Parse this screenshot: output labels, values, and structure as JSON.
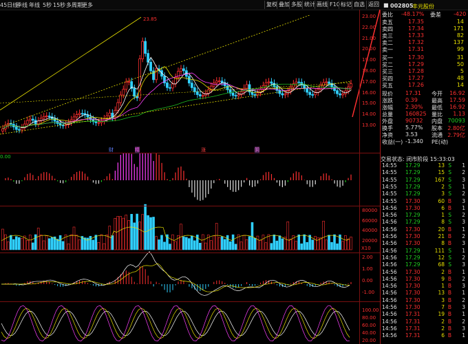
{
  "toolbar": {
    "tabs": [
      "45日线",
      "季线",
      "年线",
      "5秒",
      "15秒",
      "多周期",
      "更多"
    ],
    "buttons": [
      "复权",
      "叠加",
      "多股",
      "统计",
      "画线",
      "F10",
      "标记",
      "自选",
      "返回"
    ]
  },
  "stock": {
    "code": "002805",
    "name": "丰元股份"
  },
  "chart": {
    "high_label": "23.85",
    "price_ticks": [
      "23.00",
      "22.00",
      "21.00",
      "20.00",
      "19.00",
      "18.00",
      "17.00",
      "16.00",
      "15.00",
      "14.00",
      "13.00"
    ],
    "event_markers": [
      "财",
      "精",
      "涨",
      "阴"
    ],
    "macd_zero": "0.00",
    "vol_ticks": [
      "80000",
      "60000",
      "40000",
      "20000"
    ],
    "vol_unit": "X10",
    "osc_ticks": [
      "2.00",
      "1.00",
      "0.00",
      "-1.00"
    ],
    "kdj_ticks": [
      "100.00",
      "80.00",
      "60.00",
      "40.00",
      "20.00"
    ]
  },
  "quote": {
    "weibi_label": "委比",
    "weibi": "-48.17%",
    "weicha_label": "委差",
    "weicha": "-420",
    "asks": [
      {
        "label": "卖五",
        "price": "17.35",
        "vol": "14"
      },
      {
        "label": "卖四",
        "price": "17.34",
        "vol": "171"
      },
      {
        "label": "卖三",
        "price": "17.33",
        "vol": "82"
      },
      {
        "label": "卖二",
        "price": "17.32",
        "vol": "137"
      },
      {
        "label": "卖一",
        "price": "17.31",
        "vol": "99"
      }
    ],
    "bids": [
      {
        "label": "买一",
        "price": "17.30",
        "vol": "31"
      },
      {
        "label": "买二",
        "price": "17.29",
        "vol": "50"
      },
      {
        "label": "买三",
        "price": "17.28",
        "vol": "5"
      },
      {
        "label": "买四",
        "price": "17.27",
        "vol": "48"
      },
      {
        "label": "买五",
        "price": "17.26",
        "vol": "14"
      }
    ],
    "stats": [
      {
        "l1": "现价",
        "v1": "17.31",
        "l2": "今开",
        "v2": "16.92"
      },
      {
        "l1": "涨跌",
        "v1": "0.39",
        "l2": "最高",
        "v2": "17.59"
      },
      {
        "l1": "涨幅",
        "v1": "2.30%",
        "l2": "最低",
        "v2": "16.92"
      },
      {
        "l1": "总量",
        "v1": "160825",
        "l2": "量比",
        "v2": "1.13"
      },
      {
        "l1": "外盘",
        "v1": "90732",
        "l2": "内盘",
        "v2": "70093"
      },
      {
        "l1": "换手",
        "v1": "5.77%",
        "l2": "股本",
        "v2": "2.80亿"
      },
      {
        "l1": "净资",
        "v1": "3.53",
        "l2": "流通",
        "v2": "2.79亿"
      },
      {
        "l1": "收益(一)",
        "v1": "-1.340",
        "l2": "PE(动)",
        "v2": ""
      }
    ],
    "trade_status": "交易状态: 闭市阶段 15:33:03"
  },
  "ticks": [
    {
      "t": "14:55",
      "p": "17.29",
      "v": "13",
      "d": "S"
    },
    {
      "t": "14:55",
      "p": "17.29",
      "v": "15",
      "d": "S"
    },
    {
      "t": "14:55",
      "p": "17.29",
      "v": "167",
      "d": "S"
    },
    {
      "t": "14:55",
      "p": "17.29",
      "v": "2",
      "d": "S"
    },
    {
      "t": "14:55",
      "p": "17.29",
      "v": "3",
      "d": "S"
    },
    {
      "t": "14:55",
      "p": "17.30",
      "v": "60",
      "d": "B"
    },
    {
      "t": "14:56",
      "p": "17.30",
      "v": "6",
      "d": "B"
    },
    {
      "t": "14:56",
      "p": "17.29",
      "v": "1",
      "d": "S"
    },
    {
      "t": "14:56",
      "p": "17.29",
      "v": "8",
      "d": "S"
    },
    {
      "t": "14:56",
      "p": "17.30",
      "v": "20",
      "d": "B"
    },
    {
      "t": "14:56",
      "p": "17.30",
      "v": "21",
      "d": "B"
    },
    {
      "t": "14:56",
      "p": "17.30",
      "v": "8",
      "d": "B"
    },
    {
      "t": "14:56",
      "p": "17.29",
      "v": "111",
      "d": "S"
    },
    {
      "t": "14:56",
      "p": "17.29",
      "v": "12",
      "d": "S"
    },
    {
      "t": "14:56",
      "p": "17.29",
      "v": "68",
      "d": "S"
    },
    {
      "t": "14:56",
      "p": "17.30",
      "v": "2",
      "d": "B"
    },
    {
      "t": "14:56",
      "p": "17.30",
      "v": "9",
      "d": "B"
    },
    {
      "t": "14:56",
      "p": "17.30",
      "v": "1",
      "d": "B"
    },
    {
      "t": "14:56",
      "p": "17.30",
      "v": "13",
      "d": "B"
    },
    {
      "t": "14:56",
      "p": "17.30",
      "v": "3",
      "d": "B"
    },
    {
      "t": "14:56",
      "p": "17.30",
      "v": "7",
      "d": "B"
    },
    {
      "t": "14:56",
      "p": "17.31",
      "v": "19",
      "d": "B"
    },
    {
      "t": "14:56",
      "p": "17.31",
      "v": "2",
      "d": "B"
    },
    {
      "t": "14:56",
      "p": "17.31",
      "v": "2",
      "d": "B"
    },
    {
      "t": "14:56",
      "p": "17.31",
      "v": "6",
      "d": "B"
    }
  ]
}
